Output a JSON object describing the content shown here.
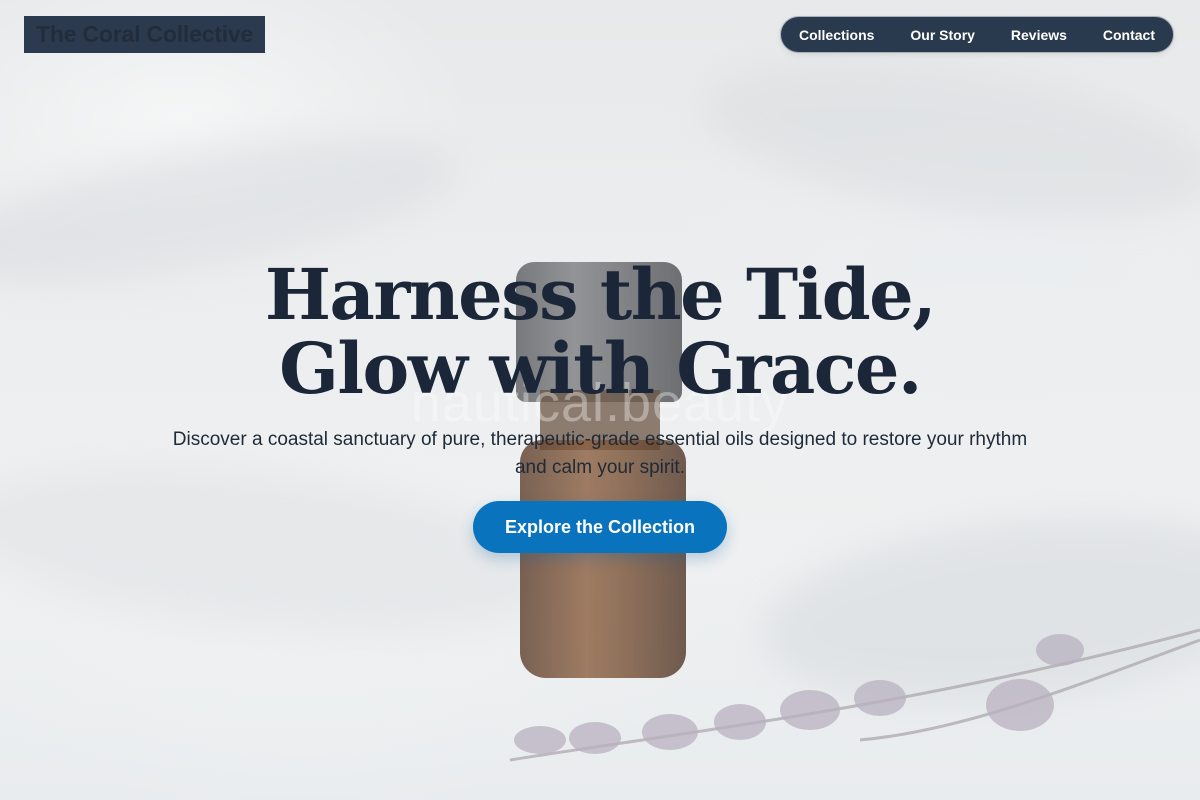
{
  "header": {
    "brand": "The Coral Collective",
    "nav": [
      "Collections",
      "Our Story",
      "Reviews",
      "Contact"
    ]
  },
  "hero": {
    "watermark": "nautical.beauty",
    "headline_line1": "Harness the Tide,",
    "headline_line2": "Glow with Grace.",
    "subtitle": "Discover a coastal sanctuary of pure, therapeutic-grade essential oils designed to restore your rhythm and calm your spirit.",
    "cta_label": "Explore the Collection"
  },
  "colors": {
    "nav_bg": "#2a3a4e",
    "headline": "#1b2639",
    "cta_bg": "#0a73bd"
  }
}
